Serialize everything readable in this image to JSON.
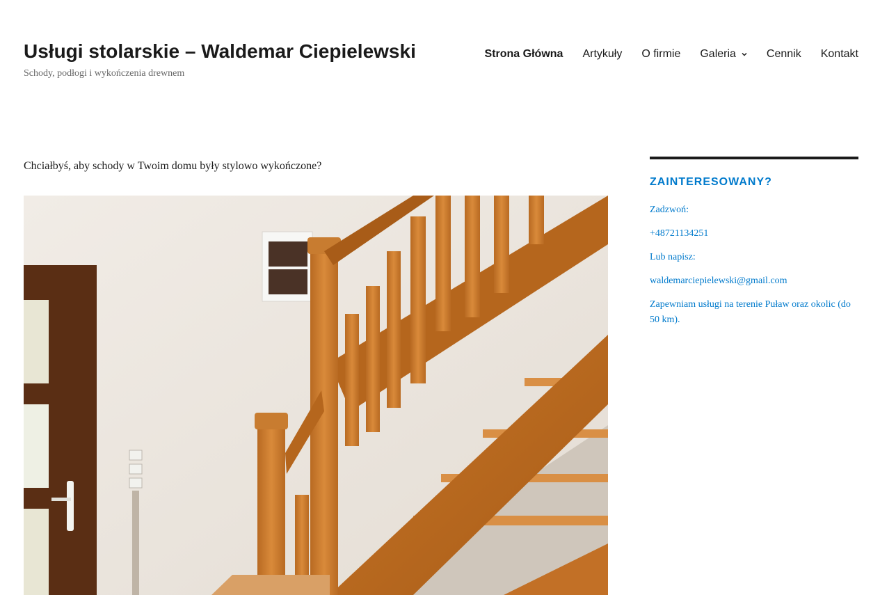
{
  "site": {
    "title": "Usługi stolarskie – Waldemar Ciepielewski",
    "description": "Schody, podłogi i wykończenia drewnem"
  },
  "nav": {
    "items": [
      {
        "label": "Strona Główna"
      },
      {
        "label": "Artykuły"
      },
      {
        "label": "O firmie"
      },
      {
        "label": "Galeria"
      },
      {
        "label": "Cennik"
      },
      {
        "label": "Kontakt"
      }
    ]
  },
  "content": {
    "intro": "Chciałbyś, aby schody w Twoim domu były stylowo wykończone?"
  },
  "sidebar": {
    "title": "ZAINTERESOWANY?",
    "call_label": "Zadzwoń:",
    "phone": "+48721134251",
    "write_label": "Lub napisz:",
    "email": "waldemarciepielewski@gmail.com",
    "area": "Zapewniam usługi na terenie Puław oraz okolic (do 50 km)."
  },
  "colors": {
    "link": "#007acc",
    "text": "#1a1a1a",
    "muted": "#686868"
  }
}
